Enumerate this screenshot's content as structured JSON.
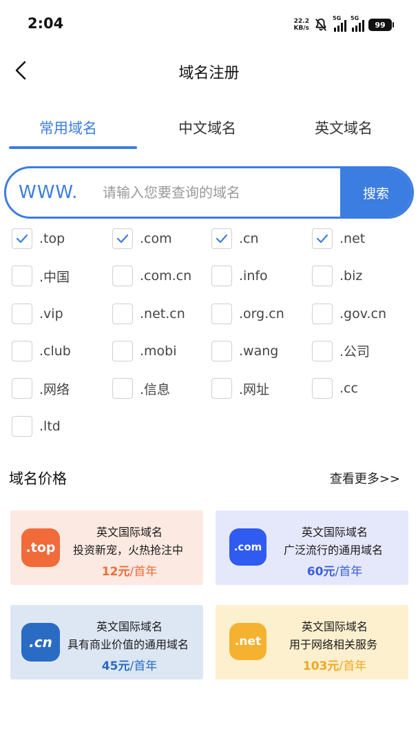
{
  "status_bar": {
    "time": "2:04",
    "net_speed_value": "22.2",
    "net_speed_unit": "KB/s",
    "signal1_label": "5G",
    "signal2_label": "5G",
    "battery": "99"
  },
  "header": {
    "title": "域名注册"
  },
  "tabs": [
    {
      "label": "常用域名",
      "active": true
    },
    {
      "label": "中文域名",
      "active": false
    },
    {
      "label": "英文域名",
      "active": false
    }
  ],
  "search": {
    "prefix": "WWW.",
    "placeholder": "请输入您要查询的域名",
    "button_label": "搜索"
  },
  "domains": [
    {
      "label": ".top",
      "checked": true
    },
    {
      "label": ".com",
      "checked": true
    },
    {
      "label": ".cn",
      "checked": true
    },
    {
      "label": ".net",
      "checked": true
    },
    {
      "label": ".中国",
      "checked": false
    },
    {
      "label": ".com.cn",
      "checked": false
    },
    {
      "label": ".info",
      "checked": false
    },
    {
      "label": ".biz",
      "checked": false
    },
    {
      "label": ".vip",
      "checked": false
    },
    {
      "label": ".net.cn",
      "checked": false
    },
    {
      "label": ".org.cn",
      "checked": false
    },
    {
      "label": ".gov.cn",
      "checked": false
    },
    {
      "label": ".club",
      "checked": false
    },
    {
      "label": ".mobi",
      "checked": false
    },
    {
      "label": ".wang",
      "checked": false
    },
    {
      "label": ".公司",
      "checked": false
    },
    {
      "label": ".网络",
      "checked": false
    },
    {
      "label": ".信息",
      "checked": false
    },
    {
      "label": ".网址",
      "checked": false
    },
    {
      "label": ".cc",
      "checked": false
    },
    {
      "label": ".ltd",
      "checked": false
    }
  ],
  "price_section": {
    "title": "域名价格",
    "more_label": "查看更多>>"
  },
  "price_cards": [
    {
      "logo_text": ".top",
      "title": "英文国际域名",
      "desc": "投资新宠，火热抢注中",
      "price": "12元",
      "unit": "/首年",
      "bg": "#fce9e1",
      "logo_bg": "#f06a3a",
      "price_color": "#f06a3a"
    },
    {
      "logo_text": ".com",
      "title": "英文国际域名",
      "desc": "广泛流行的通用域名",
      "price": "60元",
      "unit": "/首年",
      "bg": "#e5e8fb",
      "logo_bg": "#2f5bf0",
      "price_color": "#3a5fe0"
    },
    {
      "logo_text": ".cn",
      "title": "英文国际域名",
      "desc": "具有商业价值的通用域名",
      "price": "45元",
      "unit": "/首年",
      "bg": "#dce7f3",
      "logo_bg": "#2a6bc4",
      "price_color": "#2a6bc4"
    },
    {
      "logo_text": ".net",
      "title": "英文国际域名",
      "desc": "用于网络相关服务",
      "price": "103元",
      "unit": "/首年",
      "bg": "#fdf0cf",
      "logo_bg": "#f5b230",
      "price_color": "#f0a820"
    }
  ]
}
